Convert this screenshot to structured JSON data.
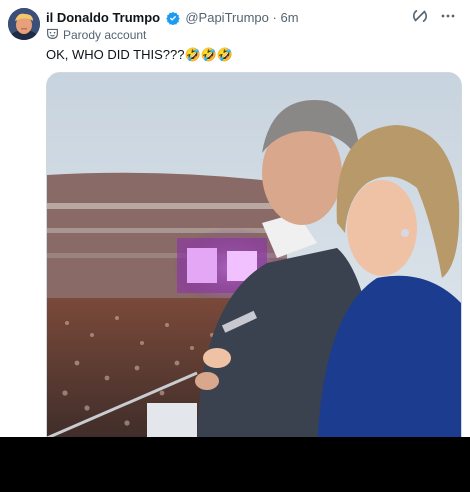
{
  "author": {
    "display_name": "il Donaldo Trumpo",
    "handle": "@PapiTrumpo",
    "time_separator": "·",
    "time": "6m",
    "label": "Parody account",
    "label_icon": "parody-mask-icon",
    "verified_color": "#1d9bf0"
  },
  "post": {
    "text": "OK, WHO DID THIS???🤣🤣🤣"
  },
  "header_icons": [
    "grok-icon",
    "more-icon"
  ]
}
